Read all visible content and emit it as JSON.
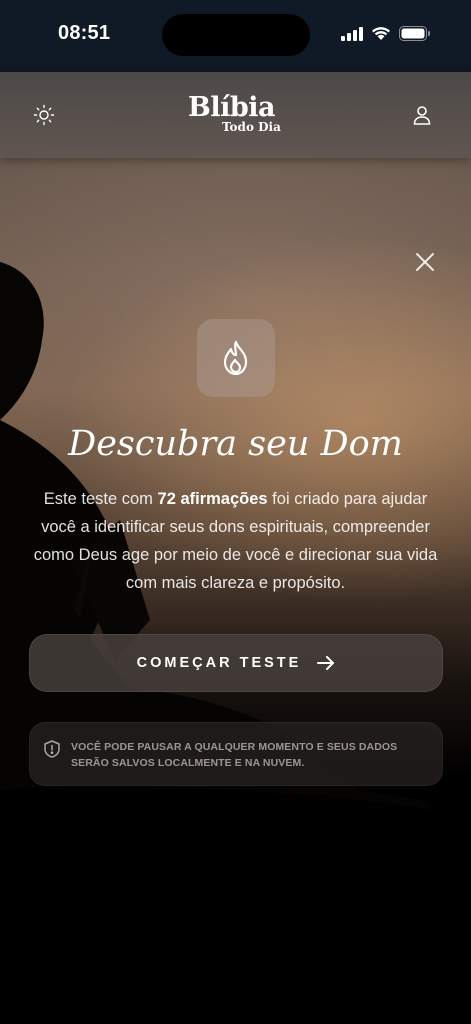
{
  "status_bar": {
    "time": "08:51",
    "icons": [
      "signal-icon",
      "wifi-icon",
      "battery-icon"
    ]
  },
  "header": {
    "logo_main": "Blíbia",
    "logo_sub": "Todo Dia",
    "left_icon": "sun-icon",
    "right_icon": "user-icon"
  },
  "modal": {
    "close_icon": "close-icon",
    "badge_icon": "flame-icon",
    "title": "Descubra seu Dom",
    "description_prefix": "Este teste com ",
    "description_bold": "72 afirmações",
    "description_suffix": " foi criado para ajudar você a identificar seus dons espirituais, compreender como Deus age por meio de você e direcionar sua vida com mais clareza e propósito.",
    "cta_label": "COMEÇAR TESTE",
    "cta_icon": "arrow-right-icon",
    "notice_icon": "shield-icon",
    "notice_text": "VOCÊ PODE PAUSAR A QUALQUER MOMENTO E SEUS DADOS SERÃO SALVOS LOCALMENTE E NA NUVEM."
  }
}
